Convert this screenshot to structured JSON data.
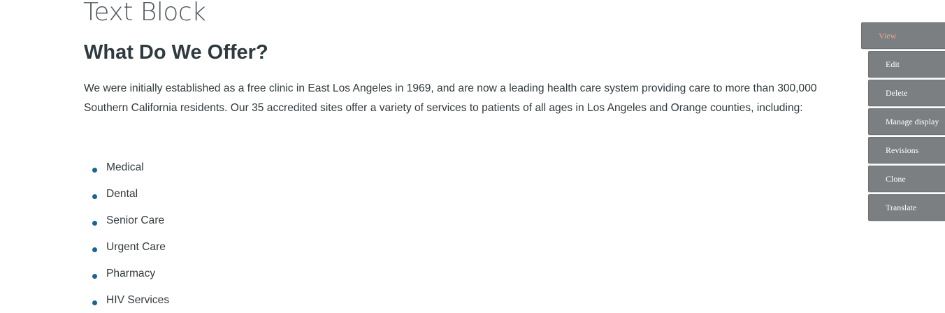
{
  "block": {
    "title": "Text Block",
    "heading": "What Do We Offer?",
    "intro": "We were initially established as a free clinic in East Los Angeles in 1969, and are now a leading health care system providing care to more than 300,000 Southern California residents. Our 35 accredited sites offer a variety of services to patients of all ages in Los Angeles and Orange counties, including:",
    "services": [
      "Medical",
      "Dental",
      "Senior Care",
      "Urgent Care",
      "Pharmacy",
      "HIV Services"
    ]
  },
  "tabs": {
    "view": "View",
    "edit": "Edit",
    "delete": "Delete",
    "manage_display": "Manage display",
    "revisions": "Revisions",
    "clone": "Clone",
    "translate": "Translate"
  },
  "colors": {
    "bullet": "#1d6394",
    "tab_background": "#7b7f82",
    "active_tab_text": "#f0a38a"
  }
}
